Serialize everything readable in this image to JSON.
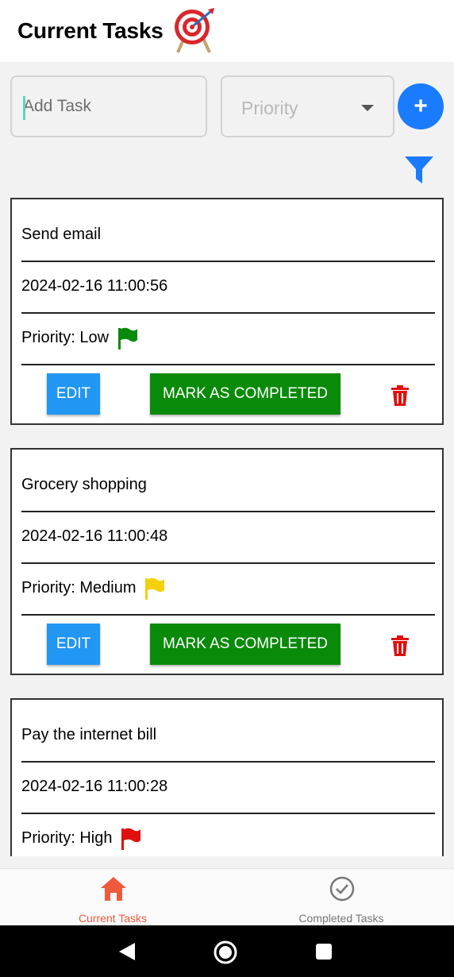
{
  "header": {
    "title": "Current Tasks",
    "icon": "target-dart-icon"
  },
  "form": {
    "task_placeholder": "Add Task",
    "priority_placeholder": "Priority",
    "add_label": "+"
  },
  "tasks": [
    {
      "title": "Send email",
      "date": "2024-02-16 11:00:56",
      "priority": "Priority: Low",
      "flag_color": "#0a8a0a"
    },
    {
      "title": "Grocery shopping",
      "date": "2024-02-16 11:00:48",
      "priority": "Priority: Medium",
      "flag_color": "#f5d00f"
    },
    {
      "title": "Pay the internet bill",
      "date": "2024-02-16 11:00:28",
      "priority": "Priority: High",
      "flag_color": "#e01010"
    }
  ],
  "actions": {
    "edit": "EDIT",
    "complete": "MARK AS COMPLETED"
  },
  "nav": {
    "current": {
      "label": "Current Tasks",
      "color": "#f05a3c",
      "icon": "home-icon"
    },
    "completed": {
      "label": "Completed Tasks",
      "color": "#777777",
      "icon": "check-circle-icon"
    }
  },
  "colors": {
    "accent": "#1a7bff",
    "edit": "#2196f3",
    "complete": "#0a8a0a",
    "delete": "#e01010"
  }
}
